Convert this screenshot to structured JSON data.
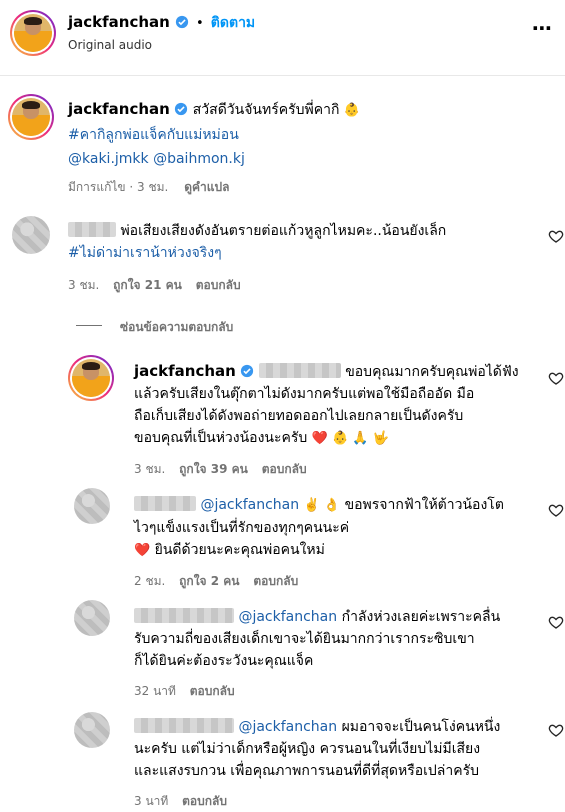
{
  "header": {
    "username": "jackfanchan",
    "dot": "•",
    "follow": "ติดตาม",
    "audio": "Original audio",
    "more": "⋯"
  },
  "caption": {
    "username": "jackfanchan",
    "text": "สวัสดีวันจันทร์ครับพี่คากิ",
    "emoji": "👶",
    "hashtag": "#คากิลูกพ่อแจ็คกับแม่หม่อน",
    "mention1": "@kaki.jmkk",
    "mention2": "@baihmon.kj",
    "edited": "มีการแก้ไข · 3 ชม.",
    "translate": "ดูคำแปล"
  },
  "comments": [
    {
      "line1": "พ่อเสียงเสียงดังอันตรายต่อแก้วหูลูกไหมคะ..น้อนยังเล็ก",
      "line2": "#ไม่ด่าม่าเราน้าห่วงจริงๆ",
      "time": "3 ชม.",
      "likes": "ถูกใจ 21 คน",
      "reply": "ตอบกลับ"
    }
  ],
  "hide_replies": "ซ่อนข้อความตอบกลับ",
  "replies": [
    {
      "username": "jackfanchan",
      "line1": "ขอบคุณมากครับคุณพ่อได้ฟัง",
      "line2": "แล้วครับเสียงในตุ๊กตาไม่ดังมากครับแต่พอใช้มือถืออัด มือ",
      "line3": "ถือเก็บเสียงได้ดังพอถ่ายทอดออกไปเลยกลายเป็นดังครับ",
      "line4": "ขอบคุณที่เป็นห่วงน้องนะครับ",
      "emojis": "❤️ 👶 🙏 🤟",
      "time": "3 ชม.",
      "likes": "ถูกใจ 39 คน",
      "reply": "ตอบกลับ"
    },
    {
      "mention": "@jackfanchan",
      "emojis": "✌️ 👌",
      "line1": "ขอพรจากฟ้าให้ต้าวน้องโต",
      "line2": "ไวๆแข็งแรงเป็นที่รักของทุกๆคนนะค่",
      "heart": "❤️",
      "line3": "ยินดีด้วยนะคะคุณพ่อคนใหม่",
      "time": "2 ชม.",
      "likes": "ถูกใจ 2 คน",
      "reply": "ตอบกลับ"
    },
    {
      "mention": "@jackfanchan",
      "line1": "กำลังห่วงเลยค่ะเพราะคลื่น",
      "line2": "รับความถี่ของเสียงเด็กเขาจะได้ยินมากกว่าเรากระซิบเขา",
      "line3": "ก็ได้ยินค่ะต้องระวังนะคุณแจ็ค",
      "time": "32 นาที",
      "reply": "ตอบกลับ"
    },
    {
      "mention": "@jackfanchan",
      "line1": "ผมอาจจะเป็นคนโง่คนหนึ่ง",
      "line2": "นะครับ แต่ไม่ว่าเด็กหรือผู้หญิง ควรนอนในที่เงียบไม่มีเสียง",
      "line3": "และแสงรบกวน เพื่อคุณภาพการนอนที่ดีที่สุดหรือเปล่าครับ",
      "time": "3 นาที",
      "reply": "ตอบกลับ"
    }
  ]
}
